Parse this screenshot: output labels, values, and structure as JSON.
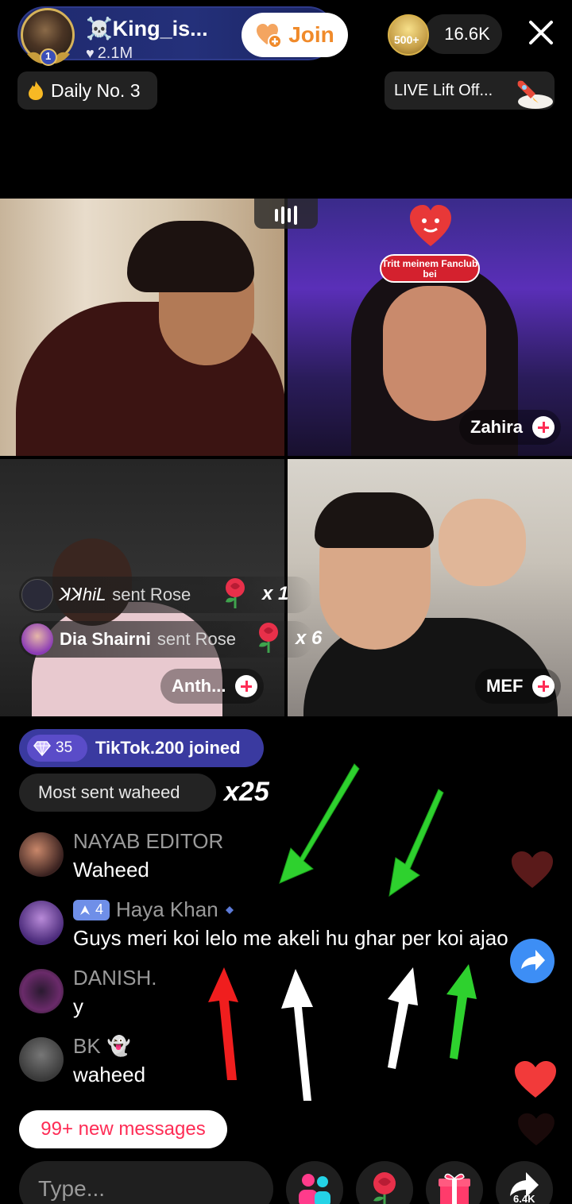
{
  "host": {
    "name": "☠️King_is...",
    "likes": "2.1M",
    "level": "1",
    "join_label": "Join"
  },
  "viewers": {
    "badge": "500+",
    "count": "16.6K"
  },
  "top_pills": {
    "daily": "Daily No. 3",
    "liftoff": "LIVE Lift Off..."
  },
  "guests": {
    "top_right_name": "Zahira",
    "fanclub_text": "Tritt meinem Fanclub bei",
    "bottom_left_name": "Anth...",
    "bottom_right_name": "MEF"
  },
  "gifts": [
    {
      "user": "ꓘꓘhiꓡ",
      "action": "sent Rose",
      "multiplier": "x 1"
    },
    {
      "user": "Dia Shairni",
      "action": "sent Rose",
      "multiplier": "x 6"
    }
  ],
  "joined": {
    "diamond_count": "35",
    "text": "TikTok.200 joined"
  },
  "most_sent": {
    "label": "Most sent waheed",
    "multiplier": "x25"
  },
  "chat": [
    {
      "name": "NAYAB EDITOR",
      "text": "Waheed"
    },
    {
      "name": "Haya Khan",
      "level": "4",
      "text": "Guys meri koi lelo me akeli hu ghar per koi ajao"
    },
    {
      "name": "DANISH.",
      "text": "y"
    },
    {
      "name": "BK",
      "text": "waheed"
    }
  ],
  "new_messages": "99+ new messages",
  "input": {
    "placeholder": "Type..."
  },
  "share_count": "6.4K",
  "colors": {
    "accent": "#fe2c55",
    "join_text": "#f08a2a",
    "joined_pill": "#3a3aa0",
    "arrow_green": "#2ed12e",
    "arrow_red": "#f01e1e",
    "arrow_white": "#ffffff"
  }
}
